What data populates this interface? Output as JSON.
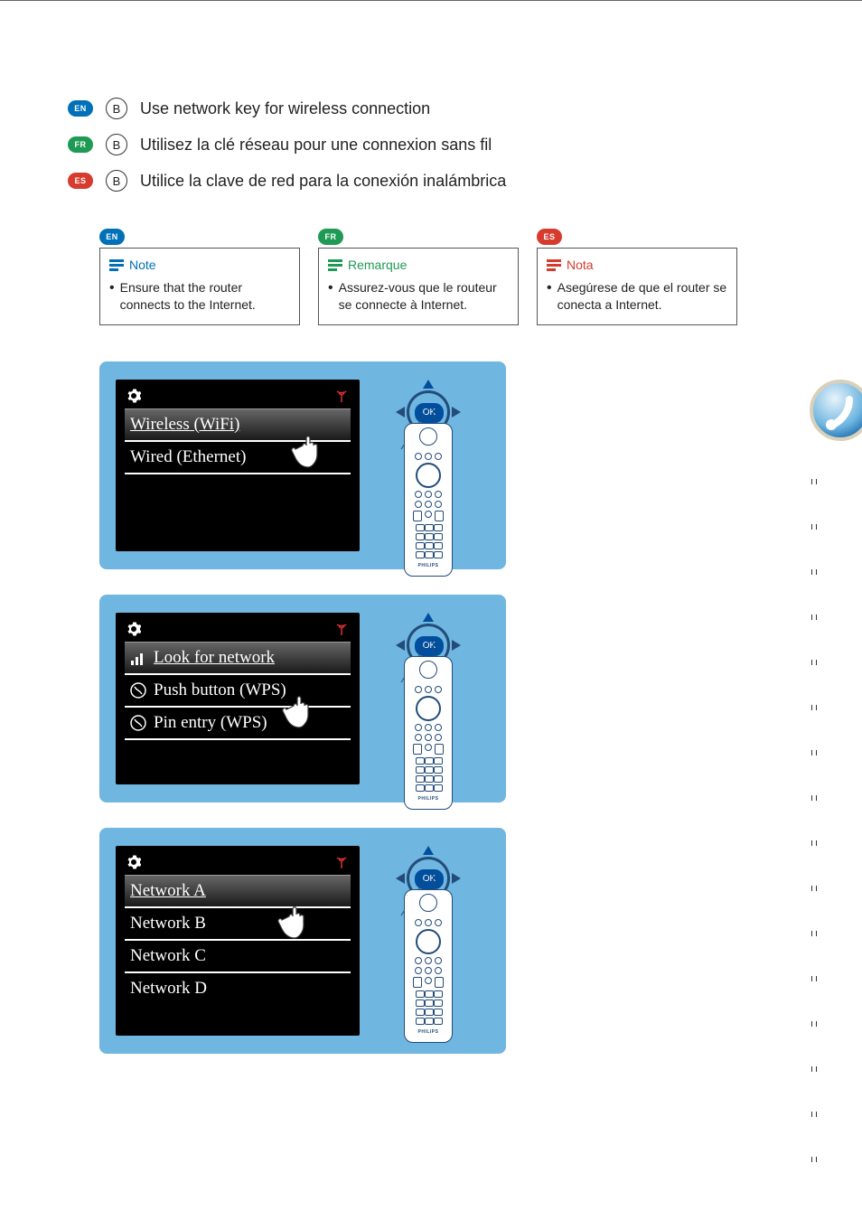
{
  "steps": [
    {
      "lang": "EN",
      "letter": "B",
      "text": "Use network key for wireless connection",
      "pillClass": "lang-en"
    },
    {
      "lang": "FR",
      "letter": "B",
      "text": "Utilisez la clé réseau pour une connexion sans fil",
      "pillClass": "lang-fr"
    },
    {
      "lang": "ES",
      "letter": "B",
      "text": "Utilice la clave de red para la conexión inalámbrica",
      "pillClass": "lang-es"
    }
  ],
  "notes": {
    "en": {
      "title": "Note",
      "body": "Ensure that the router connects to the Internet."
    },
    "fr": {
      "title": "Remarque",
      "body": "Assurez-vous que le routeur se connecte à Internet."
    },
    "es": {
      "title": "Nota",
      "body": "Asegúrese de que el router se conecta a Internet."
    }
  },
  "ok_label": "OK",
  "remote_brand": "PHILIPS",
  "screen1": {
    "items": [
      {
        "label": "Wireless (WiFi)",
        "selected": true
      },
      {
        "label": "Wired (Ethernet)",
        "selected": false
      }
    ]
  },
  "screen2": {
    "items": [
      {
        "label": "Look for network",
        "icon": "signal",
        "selected": true
      },
      {
        "label": "Push button (WPS)",
        "icon": "wps",
        "selected": false
      },
      {
        "label": "Pin entry (WPS)",
        "icon": "wps",
        "selected": false
      }
    ]
  },
  "screen3": {
    "items": [
      {
        "label": "Network A",
        "selected": true
      },
      {
        "label": "Network B",
        "selected": false
      },
      {
        "label": "Network C",
        "selected": false
      },
      {
        "label": "Network D",
        "selected": false
      }
    ]
  }
}
